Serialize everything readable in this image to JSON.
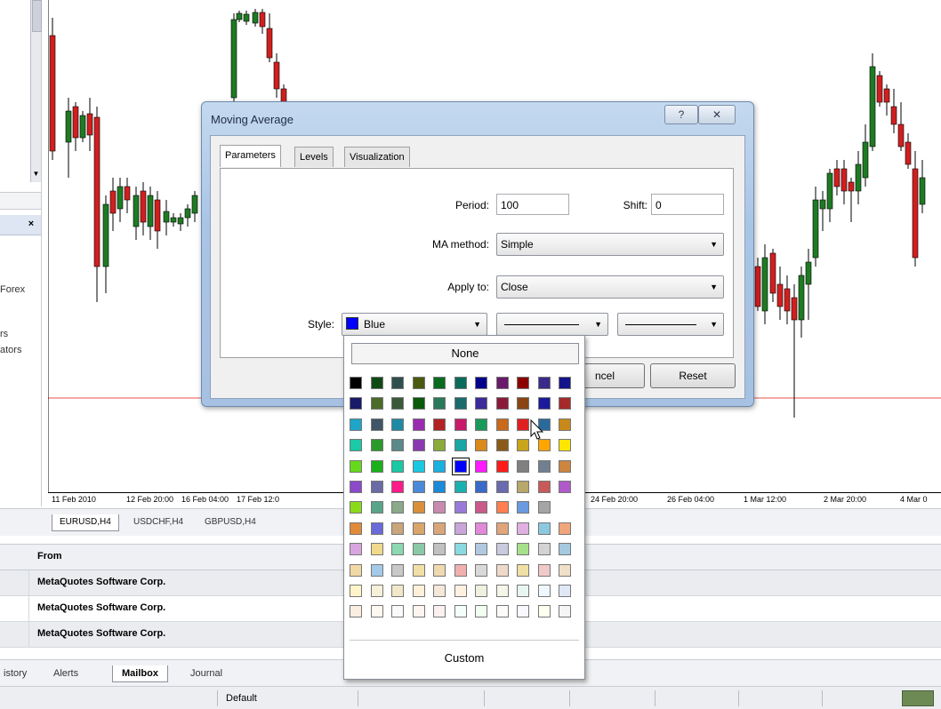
{
  "navigator": {
    "items": [
      "Forex",
      "rs",
      "ators"
    ],
    "close_glyph": "×"
  },
  "chart": {
    "time_labels": [
      "11 Feb 2010",
      "12 Feb 20:00",
      "16 Feb 04:00",
      "17 Feb 12:0",
      "24 Feb 20:00",
      "26 Feb 04:00",
      "1 Mar 12:00",
      "2 Mar 20:00",
      "4 Mar 0"
    ],
    "level_line_color": "#e8504a",
    "bull_color": "#1e7b23",
    "bear_color": "#d11f1f"
  },
  "chart_tabs": [
    "EURUSD,H4",
    "USDCHF,H4",
    "GBPUSD,H4"
  ],
  "mailbox": {
    "header": "From",
    "rows": [
      "MetaQuotes Software Corp.",
      "MetaQuotes Software Corp.",
      "MetaQuotes Software Corp."
    ]
  },
  "terminal_tabs": [
    "istory",
    "Alerts",
    "Mailbox",
    "Journal"
  ],
  "status_bar": {
    "profile": "Default"
  },
  "dialog": {
    "title": "Moving Average",
    "help_glyph": "?",
    "close_glyph": "✕",
    "tabs": [
      "Parameters",
      "Levels",
      "Visualization"
    ],
    "period_label": "Period:",
    "period_value": "100",
    "shift_label": "Shift:",
    "shift_value": "0",
    "method_label": "MA method:",
    "method_value": "Simple",
    "apply_label": "Apply to:",
    "apply_value": "Close",
    "style_label": "Style:",
    "style_color_name": "Blue",
    "style_color": "#0000ff",
    "cancel_label": "ncel",
    "reset_label": "Reset"
  },
  "color_popup": {
    "none_label": "None",
    "custom_label": "Custom",
    "selected": "#0000ff",
    "rows": [
      [
        "#000000",
        "#0f4a14",
        "#2f4f4f",
        "#4a5a0f",
        "#0a6b1f",
        "#0a6b5a",
        "#00008b",
        "#6a1a6a",
        "#8b0000",
        "#3a2a8a",
        "#14148a"
      ],
      [
        "#1a1a6a",
        "#4a6b2a",
        "#3a5a3a",
        "#0a5a0a",
        "#2a7a5a",
        "#1a6b6b",
        "#3a2a9a",
        "#8b1a3a",
        "#8b4513",
        "#1a1a9a",
        "#a52a2a"
      ],
      [
        "#1fa5c9",
        "#405566",
        "#1f8aa6",
        "#9a2ab0",
        "#b22222",
        "#c81a6a",
        "#1a9a5a",
        "#c86a1a",
        "#e02020",
        "#2a6a9a",
        "#c8881a"
      ],
      [
        "#1ac9a5",
        "#2a9a2a",
        "#5a8a8a",
        "#8a3ab0",
        "#8aaa3a",
        "#1aa5a5",
        "#da8a1a",
        "#8a5a1a",
        "#c8a51a",
        "#ffa500",
        "#ffe600"
      ],
      [
        "#66d91a",
        "#1ab01a",
        "#1ac9a5",
        "#1ac9e0",
        "#1ab0e0",
        "#0000ff",
        "#ff1aff",
        "#ff1a1a",
        "#808080",
        "#708090",
        "#cd853f"
      ],
      [
        "#8a4ac9",
        "#6a6aa5",
        "#ff1a8a",
        "#4a8ad9",
        "#1a8ad9",
        "#1ab0b0",
        "#3a6ac9",
        "#6a6ab0",
        "#b8a86a",
        "#c85a5a",
        "#b05ac9"
      ],
      [
        "#8ad91a",
        "#5aa58a",
        "#8aaa8a",
        "#d9903a",
        "#c98ab0",
        "#9a7ad9",
        "#c95a8a",
        "#ff7f50",
        "#6a9ae0",
        "#a5a5a5"
      ],
      [
        "#e08a3a",
        "#6a6ad9",
        "#c9a57a",
        "#d9a56a",
        "#d9a57a",
        "#c9a5d9",
        "#e08ad9",
        "#e0a57a",
        "#e0b0e0",
        "#8ac9e0",
        "#f0a57a"
      ],
      [
        "#d9a5e0",
        "#f0d98a",
        "#8ad9b0",
        "#8ac9a5",
        "#c0c0c0",
        "#8ad9e0",
        "#b0c9e0",
        "#c9c9e0",
        "#a5e08a",
        "#d3d3d3",
        "#a5c9e0"
      ],
      [
        "#f0d9a5",
        "#a5c9e8",
        "#c9c9c9",
        "#f0e0a5",
        "#f0d9b0",
        "#f0b0b0",
        "#d9d9d9",
        "#f0d9c9",
        "#f0e0a5",
        "#f0c9c9",
        "#f0e0c9"
      ],
      [
        "#fff5c9",
        "#f5f0d9",
        "#f0e8c9",
        "#fff0d9",
        "#f5e8d9",
        "#fff0e0",
        "#f0f0e0",
        "#f5f5e8",
        "#e8f5f0",
        "#f0f8ff",
        "#e0e8f5"
      ],
      [
        "#faeee0",
        "#fff8f0",
        "#fafafa",
        "#fff5f0",
        "#fcf0f0",
        "#f5fffa",
        "#f0fff0",
        "#fffafa",
        "#f8f8ff",
        "#fffff0",
        "#f5f5f5"
      ]
    ]
  }
}
